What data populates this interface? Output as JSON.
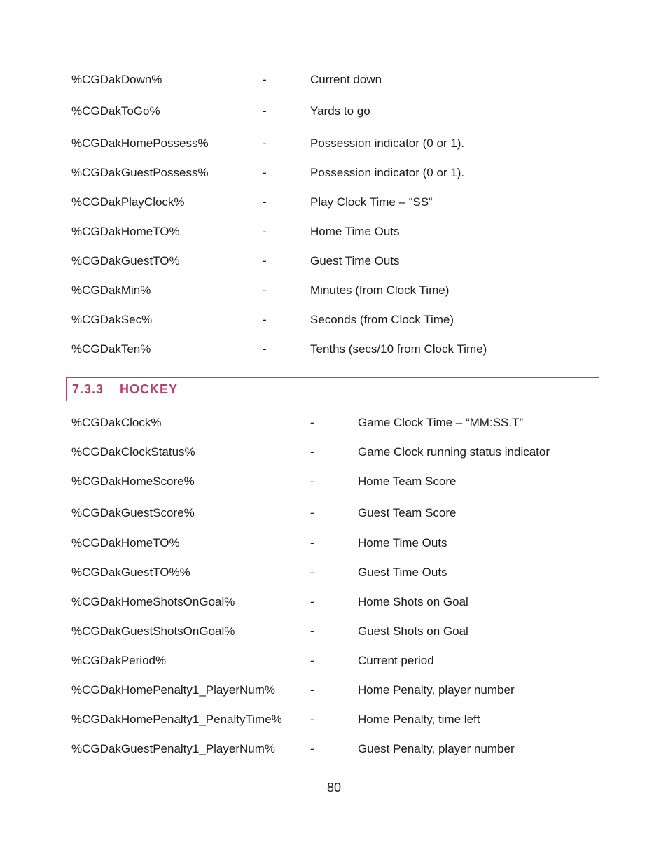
{
  "football_rows": [
    {
      "name": "%CGDakDown%",
      "dash": "-",
      "desc": "Current down"
    },
    {
      "name": "%CGDakToGo%",
      "dash": "-",
      "desc": "Yards to go"
    },
    {
      "name": "%CGDakHomePossess%",
      "dash": "-",
      "desc": "Possession indicator (0 or 1)."
    },
    {
      "name": "%CGDakGuestPossess%",
      "dash": "-",
      "desc": "Possession indicator (0 or 1)."
    },
    {
      "name": "%CGDakPlayClock%",
      "dash": "-",
      "desc": "Play Clock Time – “SS“"
    },
    {
      "name": "%CGDakHomeTO%",
      "dash": "-",
      "desc": "Home Time Outs"
    },
    {
      "name": "%CGDakGuestTO%",
      "dash": "-",
      "desc": "Guest Time Outs"
    },
    {
      "name": "%CGDakMin%",
      "dash": "-",
      "desc": "Minutes (from Clock Time)"
    },
    {
      "name": "%CGDakSec%",
      "dash": "-",
      "desc": "Seconds (from Clock Time)"
    },
    {
      "name": "%CGDakTen%",
      "dash": "-",
      "desc": "Tenths (secs/10 from Clock Time)"
    }
  ],
  "hockey_section": {
    "number": "7.3.3",
    "title": "HOCKEY"
  },
  "hockey_rows": [
    {
      "name": "%CGDakClock%",
      "dash": "-",
      "desc": "Game Clock Time – “MM:SS.T”"
    },
    {
      "name": "%CGDakClockStatus%",
      "dash": "-",
      "desc": "Game Clock running status indicator"
    },
    {
      "name": "%CGDakHomeScore%",
      "dash": "-",
      "desc": "Home Team Score"
    },
    {
      "name": "%CGDakGuestScore%",
      "dash": "-",
      "desc": "Guest Team Score"
    },
    {
      "name": "%CGDakHomeTO%",
      "dash": "-",
      "desc": "Home Time Outs"
    },
    {
      "name": "%CGDakGuestTO%%",
      "dash": "-",
      "desc": "Guest Time Outs"
    },
    {
      "name": "%CGDakHomeShotsOnGoal%",
      "dash": "-",
      "desc": "Home Shots on Goal"
    },
    {
      "name": "%CGDakGuestShotsOnGoal%",
      "dash": "-",
      "desc": "Guest Shots on Goal"
    },
    {
      "name": "%CGDakPeriod%",
      "dash": "-",
      "desc": "Current period"
    },
    {
      "name": "%CGDakHomePenalty1_PlayerNum%",
      "dash": "-",
      "desc": "Home Penalty, player number"
    },
    {
      "name": "%CGDakHomePenalty1_PenaltyTime%",
      "dash": "-",
      "desc": "Home Penalty, time left"
    },
    {
      "name": "%CGDakGuestPenalty1_PlayerNum%",
      "dash": "-",
      "desc": "Guest Penalty, player number"
    }
  ],
  "footer": {
    "page_number": "80"
  },
  "colors": {
    "heading_accent": "#b5406a",
    "body_text": "#1a1a1a"
  }
}
